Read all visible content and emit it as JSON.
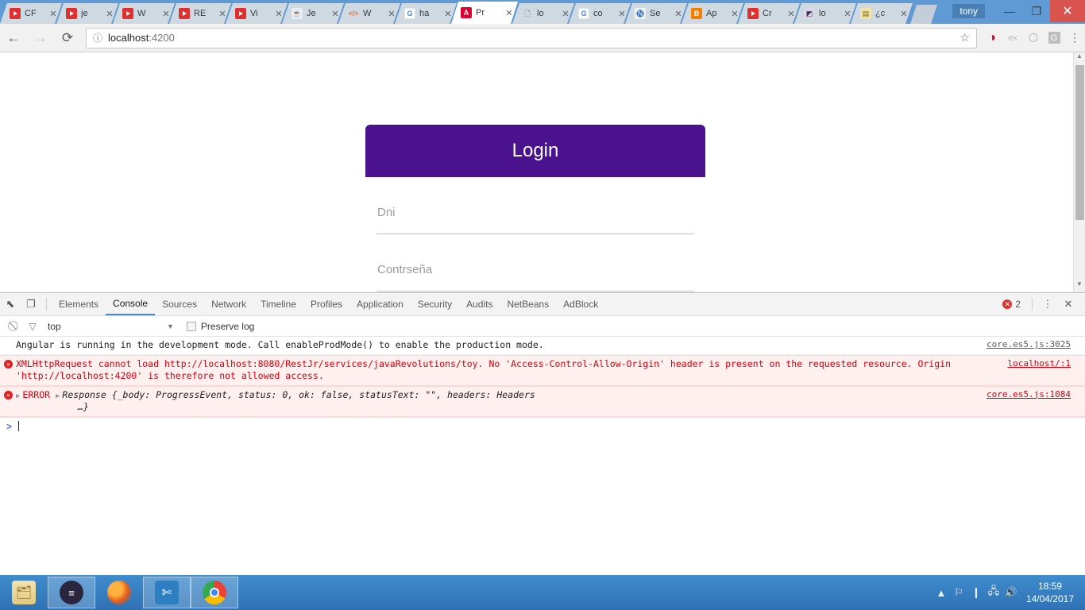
{
  "browser": {
    "tabs": [
      {
        "favicon": "youtube-icon",
        "title": "CF"
      },
      {
        "favicon": "youtube-icon",
        "title": "je"
      },
      {
        "favicon": "youtube-icon",
        "title": "W"
      },
      {
        "favicon": "youtube-icon",
        "title": "RE"
      },
      {
        "favicon": "youtube-icon",
        "title": "Vi"
      },
      {
        "favicon": "java-duke-icon",
        "title": "Je"
      },
      {
        "favicon": "code-tag-icon",
        "title": "W"
      },
      {
        "favicon": "google-icon",
        "title": "ha"
      },
      {
        "favicon": "angular-icon",
        "title": "Pr"
      },
      {
        "favicon": "page-icon",
        "title": "lo"
      },
      {
        "favicon": "google-icon",
        "title": "co"
      },
      {
        "favicon": "netbeans-icon",
        "title": "Se"
      },
      {
        "favicon": "blogger-icon",
        "title": "Ap"
      },
      {
        "favicon": "youtube-icon",
        "title": "Cr"
      },
      {
        "favicon": "eclipse-icon",
        "title": "lo"
      },
      {
        "favicon": "doc-icon",
        "title": "¿c"
      }
    ],
    "active_tab_index": 8,
    "close_glyph": "✕",
    "new_tab_label": "",
    "profile_name": "tony",
    "window_minimize": "—",
    "window_restore": "❐",
    "window_close": "✕",
    "back_glyph": "←",
    "forward_glyph": "→",
    "reload_glyph": "⟳",
    "omnibox": {
      "info_glyph": "ⓘ",
      "url_host": "localhost",
      "url_port": ":4200",
      "star_glyph": "☆"
    },
    "extensions": [
      {
        "name": "opera-vpn-icon",
        "glyph": "◑"
      },
      {
        "name": "ex-extension-icon",
        "glyph": "ex"
      },
      {
        "name": "cube-extension-icon",
        "glyph": "⬡"
      },
      {
        "name": "g-extension-icon",
        "glyph": "G"
      }
    ],
    "menu_glyph": "⋮"
  },
  "page": {
    "login_card": {
      "title": "Login",
      "header_color": "#4A128C",
      "fields": [
        {
          "name": "dni",
          "label": "Dni",
          "value": ""
        },
        {
          "name": "password",
          "label": "Contrseña",
          "value": ""
        }
      ]
    },
    "scrollbar": {
      "up_glyph": "▲",
      "down_glyph": "▼"
    }
  },
  "devtools": {
    "inspect_glyph": "⬉",
    "device_glyph": "❐",
    "tabs": [
      "Elements",
      "Console",
      "Sources",
      "Network",
      "Timeline",
      "Profiles",
      "Application",
      "Security",
      "Audits",
      "NetBeans",
      "AdBlock"
    ],
    "selected_tab": "Console",
    "error_count": "2",
    "error_badge_glyph": "✕",
    "more_glyph": "⋮",
    "close_glyph": "✕",
    "filterbar": {
      "clear_glyph": "⃠",
      "filter_glyph": "▽",
      "context": "top",
      "caret_glyph": "▼",
      "preserve_log_label": "Preserve log",
      "preserve_log_checked": false
    },
    "console_rows": [
      {
        "severity": "info",
        "text": "Angular is running in the development mode. Call enableProdMode() to enable the production mode.",
        "source": "core.es5.js:3025"
      },
      {
        "severity": "error",
        "seg_pre": "XMLHttpRequest cannot load ",
        "seg_link": "http://localhost:8080/RestJr/services/javaRevolutions/toy",
        "seg_mid": ". No 'Access-Control-Allow-Origin' header is present on the requested resource. Origin '",
        "seg_link2": "http://localhost:4200",
        "seg_post": "' is therefore not allowed access.",
        "source": "localhost/:1"
      },
      {
        "severity": "error",
        "expand_glyph": "▶",
        "error_tag": "ERROR",
        "object_head": "Response",
        "object_body": "{_body: ProgressEvent, status: 0, ok: false, statusText: \"\", headers: Headers",
        "object_tail": "…}",
        "source": "core.es5.js:1084"
      }
    ],
    "prompt": {
      "glyph": ">",
      "value": ""
    }
  },
  "taskbar": {
    "items": [
      {
        "name": "file-explorer-icon",
        "glyph": "🗂",
        "open": false
      },
      {
        "name": "eclipse-icon",
        "glyph": "≡",
        "open": true
      },
      {
        "name": "firefox-icon",
        "glyph": "",
        "open": false
      },
      {
        "name": "vscode-icon",
        "glyph": "✄",
        "open": true
      },
      {
        "name": "chrome-icon",
        "glyph": "",
        "open": true
      }
    ],
    "tray": [
      {
        "name": "show-hidden-icons",
        "glyph": "▲"
      },
      {
        "name": "flag-action-center-icon",
        "glyph": "⚐"
      },
      {
        "name": "battery-icon",
        "glyph": "❙"
      },
      {
        "name": "network-icon",
        "glyph": "🖧"
      },
      {
        "name": "volume-icon",
        "glyph": "🔊"
      }
    ],
    "time": "18:59",
    "date": "14/04/2017"
  }
}
